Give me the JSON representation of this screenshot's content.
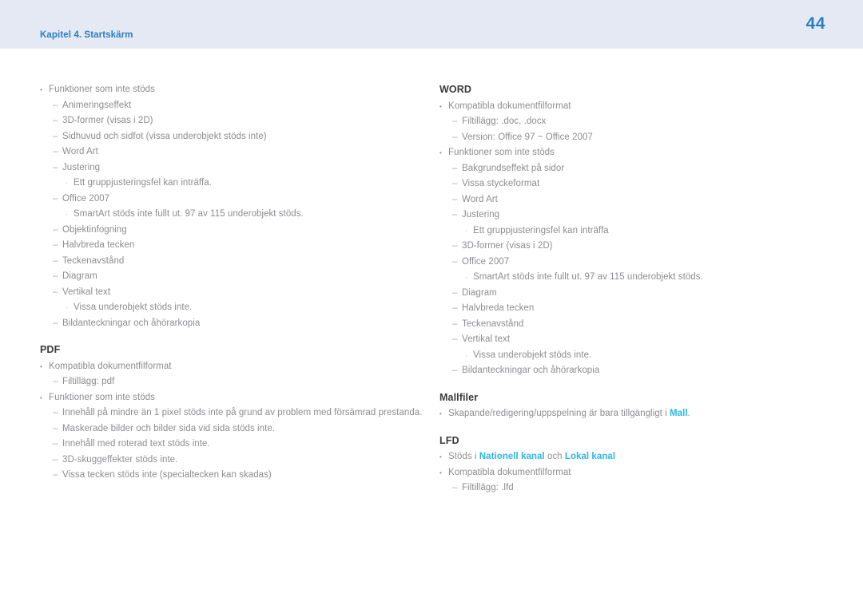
{
  "header": {
    "chapter": "Kapitel 4. Startskärm",
    "page_number": "44",
    "band_color": "#e4e9f4",
    "accent_color": "#2a7ec2"
  },
  "theme": {
    "heading_color": "#3a3a3c",
    "body_color": "#8d8d91",
    "link_color": "#2bb7e8"
  },
  "columns": [
    {
      "id": "left",
      "sections": [
        {
          "heading": null,
          "items": [
            {
              "level": 1,
              "text": "Funktioner som inte stöds"
            },
            {
              "level": 2,
              "text": "Animeringseffekt"
            },
            {
              "level": 2,
              "text": "3D-former (visas i 2D)"
            },
            {
              "level": 2,
              "text": "Sidhuvud och sidfot (vissa underobjekt stöds inte)"
            },
            {
              "level": 2,
              "text": "Word Art"
            },
            {
              "level": 2,
              "text": "Justering"
            },
            {
              "level": 3,
              "text": "Ett gruppjusteringsfel kan inträffa."
            },
            {
              "level": 2,
              "text": "Office 2007"
            },
            {
              "level": 3,
              "text": "SmartArt stöds inte fullt ut. 97 av 115 underobjekt stöds."
            },
            {
              "level": 2,
              "text": "Objektinfogning"
            },
            {
              "level": 2,
              "text": "Halvbreda tecken"
            },
            {
              "level": 2,
              "text": "Teckenavstånd"
            },
            {
              "level": 2,
              "text": "Diagram"
            },
            {
              "level": 2,
              "text": "Vertikal text"
            },
            {
              "level": 3,
              "text": "Vissa underobjekt stöds inte."
            },
            {
              "level": 2,
              "text": "Bildanteckningar och åhörarkopia"
            }
          ]
        },
        {
          "heading": "PDF",
          "items": [
            {
              "level": 1,
              "text": "Kompatibla dokumentfilformat"
            },
            {
              "level": 2,
              "text": "Filtillägg: pdf"
            },
            {
              "level": 1,
              "text": "Funktioner som inte stöds"
            },
            {
              "level": 2,
              "text": "Innehåll på mindre än 1 pixel stöds inte på grund av problem med försämrad prestanda."
            },
            {
              "level": 2,
              "text": "Maskerade bilder och bilder sida vid sida stöds inte."
            },
            {
              "level": 2,
              "text": "Innehåll med roterad text stöds inte."
            },
            {
              "level": 2,
              "text": "3D-skuggeffekter stöds inte."
            },
            {
              "level": 2,
              "text": "Vissa tecken stöds inte (specialtecken kan skadas)"
            }
          ]
        }
      ]
    },
    {
      "id": "right",
      "sections": [
        {
          "heading": "WORD",
          "items": [
            {
              "level": 1,
              "text": "Kompatibla dokumentfilformat"
            },
            {
              "level": 2,
              "text": "Filtillägg: .doc, .docx"
            },
            {
              "level": 2,
              "text": "Version: Office 97 ~ Office 2007"
            },
            {
              "level": 1,
              "text": "Funktioner som inte stöds"
            },
            {
              "level": 2,
              "text": "Bakgrundseffekt på sidor"
            },
            {
              "level": 2,
              "text": "Vissa styckeformat"
            },
            {
              "level": 2,
              "text": "Word Art"
            },
            {
              "level": 2,
              "text": "Justering"
            },
            {
              "level": 3,
              "text": "Ett gruppjusteringsfel kan inträffa"
            },
            {
              "level": 2,
              "text": "3D-former (visas i 2D)"
            },
            {
              "level": 2,
              "text": "Office 2007"
            },
            {
              "level": 3,
              "text": "SmartArt stöds inte fullt ut. 97 av 115 underobjekt stöds."
            },
            {
              "level": 2,
              "text": "Diagram"
            },
            {
              "level": 2,
              "text": "Halvbreda tecken"
            },
            {
              "level": 2,
              "text": "Teckenavstånd"
            },
            {
              "level": 2,
              "text": "Vertikal text"
            },
            {
              "level": 3,
              "text": "Vissa underobjekt stöds inte."
            },
            {
              "level": 2,
              "text": "Bildanteckningar och åhörarkopia"
            }
          ]
        },
        {
          "heading": "Mallfiler",
          "items": [
            {
              "level": 1,
              "parts": [
                {
                  "type": "text",
                  "text": "Skapande/redigering/uppspelning är bara tillgängligt i "
                },
                {
                  "type": "link",
                  "text": "Mall"
                },
                {
                  "type": "text",
                  "text": "."
                }
              ]
            }
          ]
        },
        {
          "heading": "LFD",
          "items": [
            {
              "level": 1,
              "parts": [
                {
                  "type": "text",
                  "text": "Stöds i "
                },
                {
                  "type": "link",
                  "text": "Nationell kanal"
                },
                {
                  "type": "text",
                  "text": " och "
                },
                {
                  "type": "link",
                  "text": "Lokal kanal"
                }
              ]
            },
            {
              "level": 1,
              "text": "Kompatibla dokumentfilformat"
            },
            {
              "level": 2,
              "text": "Filtillägg: .lfd"
            }
          ]
        }
      ]
    }
  ]
}
